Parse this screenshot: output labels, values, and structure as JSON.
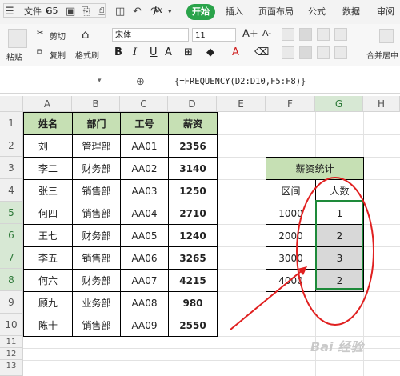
{
  "menu": {
    "file": "文件",
    "start": "开始",
    "items": [
      "插入",
      "页面布局",
      "公式",
      "数据",
      "审阅"
    ]
  },
  "ribbon": {
    "paste": "粘贴",
    "cut": "剪切",
    "copy": "复制",
    "format_painter": "格式刷",
    "font_name": "宋体",
    "font_size": "11",
    "merge_center": "合并居中",
    "font_grow": "A+",
    "font_shrink": "A-"
  },
  "formula_bar": {
    "cell_ref": "G5",
    "fx": "fx",
    "formula": "{=FREQUENCY(D2:D10,F5:F8)}"
  },
  "grid": {
    "columns": [
      "A",
      "B",
      "C",
      "D",
      "E",
      "F",
      "G",
      "H"
    ],
    "rows": [
      "1",
      "2",
      "3",
      "4",
      "5",
      "6",
      "7",
      "8",
      "9",
      "10",
      "11",
      "12",
      "13"
    ],
    "selected_column": "G",
    "selected_rows": [
      "5",
      "6",
      "7",
      "8"
    ]
  },
  "table": {
    "headers": [
      "姓名",
      "部门",
      "工号",
      "薪资"
    ],
    "rows": [
      [
        "刘一",
        "管理部",
        "AA01",
        "2356"
      ],
      [
        "李二",
        "财务部",
        "AA02",
        "3140"
      ],
      [
        "张三",
        "销售部",
        "AA03",
        "1250"
      ],
      [
        "何四",
        "销售部",
        "AA04",
        "2710"
      ],
      [
        "王七",
        "财务部",
        "AA05",
        "1240"
      ],
      [
        "李五",
        "销售部",
        "AA06",
        "3265"
      ],
      [
        "何六",
        "财务部",
        "AA07",
        "4215"
      ],
      [
        "顾九",
        "业务部",
        "AA08",
        "980"
      ],
      [
        "陈十",
        "销售部",
        "AA09",
        "2550"
      ]
    ]
  },
  "stats": {
    "title": "薪资统计",
    "col_interval": "区间",
    "col_count": "人数",
    "rows": [
      [
        "1000",
        "1"
      ],
      [
        "2000",
        "2"
      ],
      [
        "3000",
        "3"
      ],
      [
        "4000",
        "2"
      ]
    ]
  },
  "watermark": "Bai 经验",
  "colors": {
    "start_green": "#2aa34a",
    "header_fill": "#c6e0b4",
    "annotation_red": "#e02020",
    "selection_green": "#1e8a3a"
  }
}
